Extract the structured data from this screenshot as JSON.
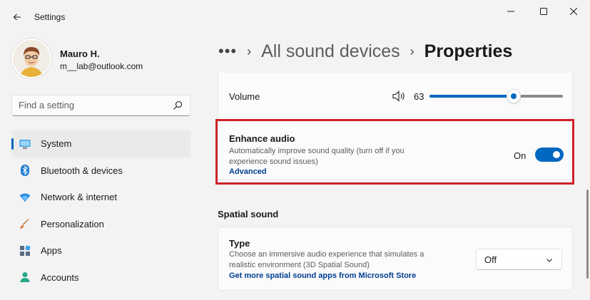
{
  "window": {
    "title": "Settings",
    "controls": {
      "minimize": "minimize-icon",
      "maximize": "maximize-icon",
      "close": "close-icon"
    }
  },
  "user": {
    "name": "Mauro H.",
    "email": "m__lab@outlook.com"
  },
  "search": {
    "placeholder": "Find a setting"
  },
  "sidebar": {
    "items": [
      {
        "label": "System",
        "icon": "monitor-icon",
        "active": true
      },
      {
        "label": "Bluetooth & devices",
        "icon": "bluetooth-icon"
      },
      {
        "label": "Network & internet",
        "icon": "wifi-icon"
      },
      {
        "label": "Personalization",
        "icon": "brush-icon"
      },
      {
        "label": "Apps",
        "icon": "apps-icon"
      },
      {
        "label": "Accounts",
        "icon": "person-icon"
      }
    ]
  },
  "breadcrumb": {
    "more": "•••",
    "parent": "All sound devices",
    "current": "Properties"
  },
  "volume": {
    "label": "Volume",
    "value": "63",
    "level": 0.63
  },
  "enhance": {
    "title": "Enhance audio",
    "description": "Automatically improve sound quality (turn off if you experience sound issues)",
    "link": "Advanced",
    "toggle_label": "On",
    "toggle_on": true
  },
  "spatial": {
    "section_title": "Spatial sound",
    "type_title": "Type",
    "type_description": "Choose an immersive audio experience that simulates a realistic environment (3D Spatial Sound)",
    "type_link": "Get more spatial sound apps from Microsoft Store",
    "dropdown_value": "Off"
  },
  "colors": {
    "accent": "#0067c0",
    "highlight": "#d0222a"
  }
}
